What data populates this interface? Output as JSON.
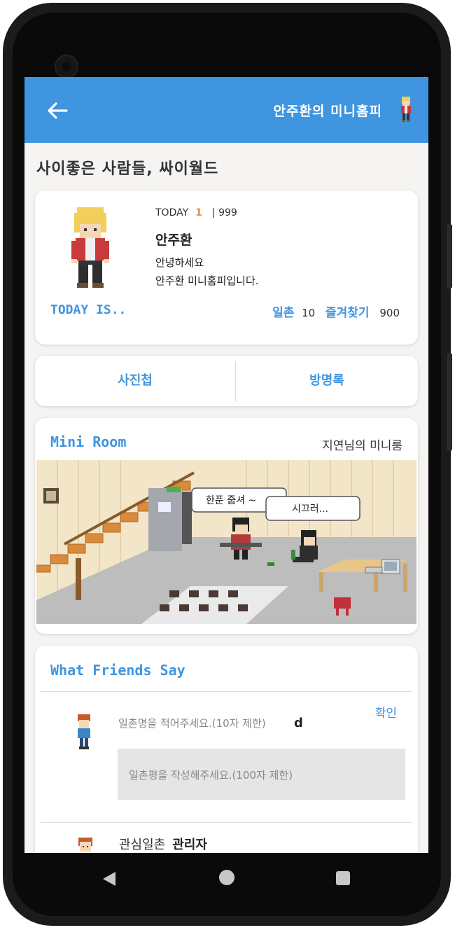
{
  "appbar": {
    "title": "안주환의 미니홈피"
  },
  "headline": "사이좋은 사람들, 싸이월드",
  "profile": {
    "today_label": "TODAY",
    "today_count": "1",
    "total": "| 999",
    "name": "안주환",
    "greeting_line1": "안녕하세요",
    "greeting_line2": "안주환 미니홈피입니다.",
    "today_is": "TODAY IS..",
    "ilchon_label": "일촌",
    "ilchon_count": "10",
    "favorites_label": "즐겨찾기",
    "favorites_count": "900"
  },
  "tabs": [
    {
      "label": "사진첩"
    },
    {
      "label": "방명록"
    }
  ],
  "miniroom": {
    "title": "Mini Room",
    "owner": "지연님의 미니룸",
    "bubble1": "한푼 줍셔 ~",
    "bubble2": "시끄러..."
  },
  "friends": {
    "title": "What Friends Say",
    "confirm": "확인",
    "nickname_placeholder": "일촌명을 적어주세요.(10자 제한)",
    "nickname_value": "d",
    "review_placeholder": "일촌평을 작성해주세요.(100자 제한)",
    "interest_label": "관심일촌",
    "interest_value": "관리자"
  },
  "colors": {
    "accent": "#3f95e0",
    "today_count": "#ec8a4b"
  }
}
